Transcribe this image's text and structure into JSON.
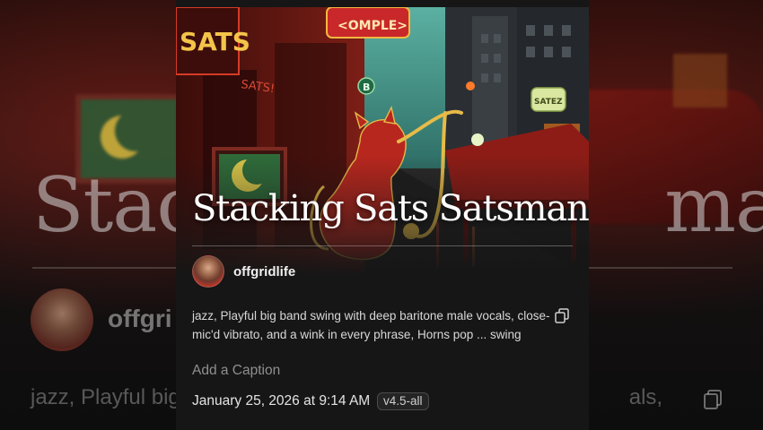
{
  "song": {
    "title": "Stacking Sats Satsman",
    "artist": "offgridlife",
    "description": "jazz, Playful big band swing with deep baritone male vocals, close-mic'd vibrato, and a wink in every phrase, Horns pop ... swing",
    "caption_placeholder": "Add a Caption",
    "created_at": "January 25, 2026 at 9:14 AM",
    "model_badge": "v4.5-all"
  },
  "background": {
    "title_left": "Stack",
    "title_right": "man",
    "user_partial": "offgri",
    "desc_left": "jazz, Playful big",
    "desc_right": "als,"
  },
  "artwork": {
    "signs": [
      "SATS",
      "SATS!",
      "OMPLE",
      "B",
      "SATEZ"
    ]
  },
  "icons": {
    "copy": "copy-icon"
  },
  "colors": {
    "card_bg": "#161616",
    "accent_red": "#c8362a",
    "neon_yellow": "#f3c23a",
    "teal_sky": "#3e8e84"
  }
}
